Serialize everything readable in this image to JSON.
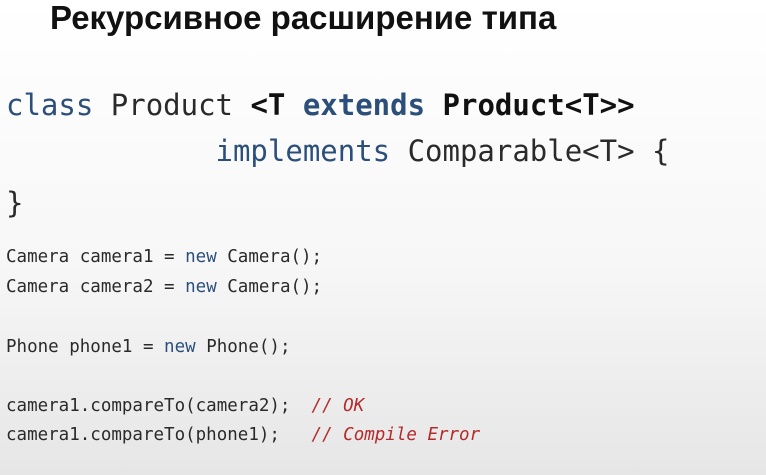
{
  "title": "Рекурсивное расширение типа",
  "declaration": {
    "kw_class": "class",
    "name": " Product ",
    "param_open": "<T ",
    "kw_extends": "extends",
    "bound": " Product<T>>",
    "indent": "            ",
    "kw_implements": "implements",
    "iface": " Comparable<T> {",
    "close": "}"
  },
  "usage": {
    "l1_a": "Camera camera1 = ",
    "l1_kw": "new",
    "l1_b": " Camera();",
    "l2_a": "Camera camera2 = ",
    "l2_kw": "new",
    "l2_b": " Camera();",
    "l3_a": "Phone phone1 = ",
    "l3_kw": "new",
    "l3_b": " Phone();",
    "l4_code": "camera1.compareTo(camera2);  ",
    "l4_comment": "// OK",
    "l5_code": "camera1.compareTo(phone1);   ",
    "l5_comment": "// Compile Error"
  }
}
